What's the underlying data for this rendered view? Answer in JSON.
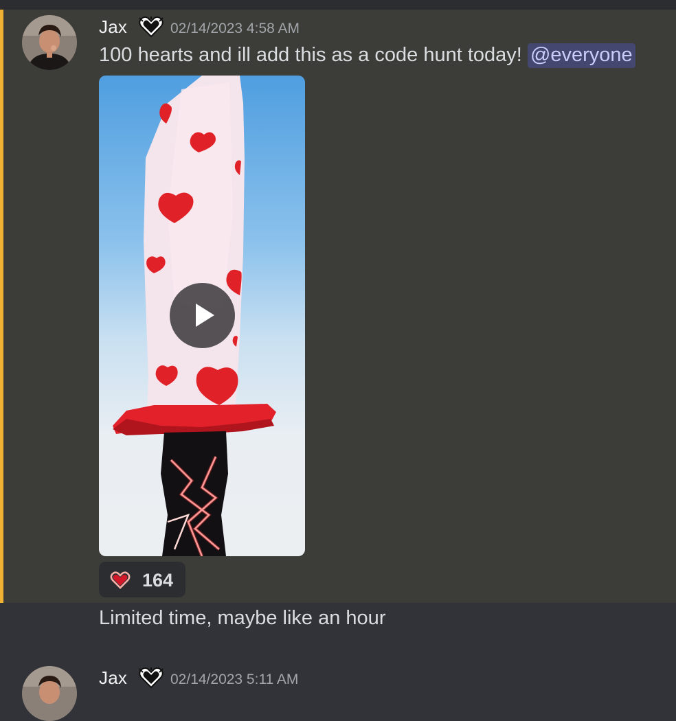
{
  "colors": {
    "background": "#313338",
    "highlight": "#3c3c38",
    "mention_bar": "#f0b232",
    "mention_bg": "#3f4779",
    "mention_text": "#c9cdfb",
    "timestamp": "#a3a6aa"
  },
  "messages": [
    {
      "author": "Jax",
      "badge_icon": "heart-badge-icon",
      "timestamp": "02/14/2023 4:58 AM",
      "text": "100 hearts and ill add this as a code hunt today! ",
      "mention": "@everyone",
      "attachment": {
        "type": "video",
        "icon": "play-icon"
      },
      "reactions": [
        {
          "emoji": "heart-outline-icon",
          "count": "164"
        }
      ]
    },
    {
      "text": "Limited time, maybe like an hour"
    },
    {
      "author": "Jax",
      "badge_icon": "heart-badge-icon",
      "timestamp": "02/14/2023 5:11 AM"
    }
  ]
}
